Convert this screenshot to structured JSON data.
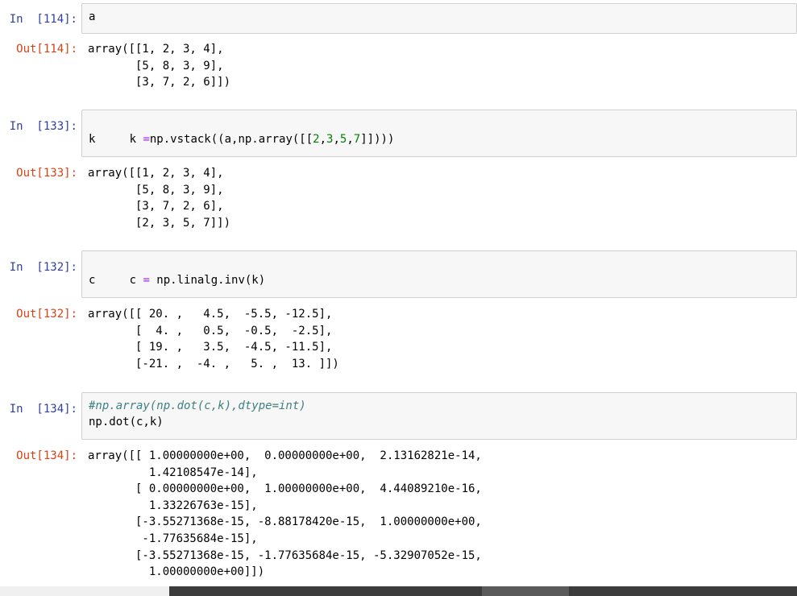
{
  "cells": [
    {
      "in_prompt": "In  [114]:",
      "input_lines": [
        "a"
      ],
      "out_prompt": "Out[114]:",
      "output_lines": [
        "array([[1, 2, 3, 4],",
        "       [5, 8, 3, 9],",
        "       [3, 7, 2, 6]])"
      ]
    },
    {
      "in_prompt": "In  [133]:",
      "input_lines": [
        "k =np.vstack((a,np.array([[2,3,5,7]])))",
        "k"
      ],
      "out_prompt": "Out[133]:",
      "output_lines": [
        "array([[1, 2, 3, 4],",
        "       [5, 8, 3, 9],",
        "       [3, 7, 2, 6],",
        "       [2, 3, 5, 7]])"
      ]
    },
    {
      "in_prompt": "In  [132]:",
      "input_lines": [
        "c = np.linalg.inv(k)",
        "c"
      ],
      "out_prompt": "Out[132]:",
      "output_lines": [
        "array([[ 20. ,   4.5,  -5.5, -12.5],",
        "       [  4. ,   0.5,  -0.5,  -2.5],",
        "       [ 19. ,   3.5,  -4.5, -11.5],",
        "       [-21. ,  -4. ,   5. ,  13. ]])"
      ]
    },
    {
      "in_prompt": "In  [134]:",
      "input_lines": [
        "#np.array(np.dot(c,k),dtype=int)",
        "np.dot(c,k)"
      ],
      "out_prompt": "Out[134]:",
      "output_lines": [
        "array([[ 1.00000000e+00,  0.00000000e+00,  2.13162821e-14,",
        "         1.42108547e-14],",
        "       [ 0.00000000e+00,  1.00000000e+00,  4.44089210e-16,",
        "         1.33226763e-15],",
        "       [-3.55271368e-15, -8.88178420e-15,  1.00000000e+00,",
        "        -1.77635684e-15],",
        "       [-3.55271368e-15, -1.77635684e-15, -5.32907052e-15,",
        "         1.00000000e+00]])"
      ]
    }
  ],
  "colors": {
    "in_prompt": "#303F9F",
    "out_prompt": "#D84315",
    "input_bg": "#f7f7f7",
    "input_border": "#cfcfcf"
  }
}
